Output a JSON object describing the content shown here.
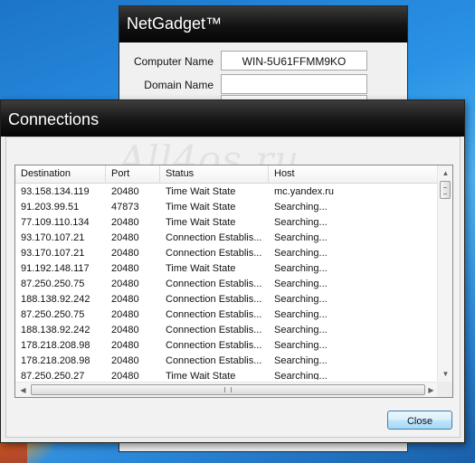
{
  "netgadget": {
    "title": "NetGadget™",
    "computer_name_label": "Computer Name",
    "computer_name_value": "WIN-5U61FFMM9KO",
    "domain_name_label": "Domain Name",
    "domain_name_value": ""
  },
  "connections": {
    "title": "Connections",
    "watermark": "All4os.ru",
    "columns": {
      "destination": "Destination",
      "port": "Port",
      "status": "Status",
      "host": "Host"
    },
    "rows": [
      {
        "destination": "93.158.134.119",
        "port": "20480",
        "status": "Time Wait State",
        "host": "mc.yandex.ru"
      },
      {
        "destination": "91.203.99.51",
        "port": "47873",
        "status": "Time Wait State",
        "host": "Searching..."
      },
      {
        "destination": "77.109.110.134",
        "port": "20480",
        "status": "Time Wait State",
        "host": "Searching..."
      },
      {
        "destination": "93.170.107.21",
        "port": "20480",
        "status": "Connection Establis...",
        "host": "Searching..."
      },
      {
        "destination": "93.170.107.21",
        "port": "20480",
        "status": "Connection Establis...",
        "host": "Searching..."
      },
      {
        "destination": "91.192.148.117",
        "port": "20480",
        "status": "Time Wait State",
        "host": "Searching..."
      },
      {
        "destination": "87.250.250.75",
        "port": "20480",
        "status": "Connection Establis...",
        "host": "Searching..."
      },
      {
        "destination": "188.138.92.242",
        "port": "20480",
        "status": "Connection Establis...",
        "host": "Searching..."
      },
      {
        "destination": "87.250.250.75",
        "port": "20480",
        "status": "Connection Establis...",
        "host": "Searching..."
      },
      {
        "destination": "188.138.92.242",
        "port": "20480",
        "status": "Connection Establis...",
        "host": "Searching..."
      },
      {
        "destination": "178.218.208.98",
        "port": "20480",
        "status": "Connection Establis...",
        "host": "Searching..."
      },
      {
        "destination": "178.218.208.98",
        "port": "20480",
        "status": "Connection Establis...",
        "host": "Searching..."
      },
      {
        "destination": "87.250.250.27",
        "port": "20480",
        "status": "Time Wait State",
        "host": "Searching..."
      }
    ],
    "close_label": "Close"
  },
  "icons": {
    "scroll_up": "▲",
    "scroll_down": "▼",
    "scroll_left": "◀",
    "scroll_right": "▶"
  }
}
